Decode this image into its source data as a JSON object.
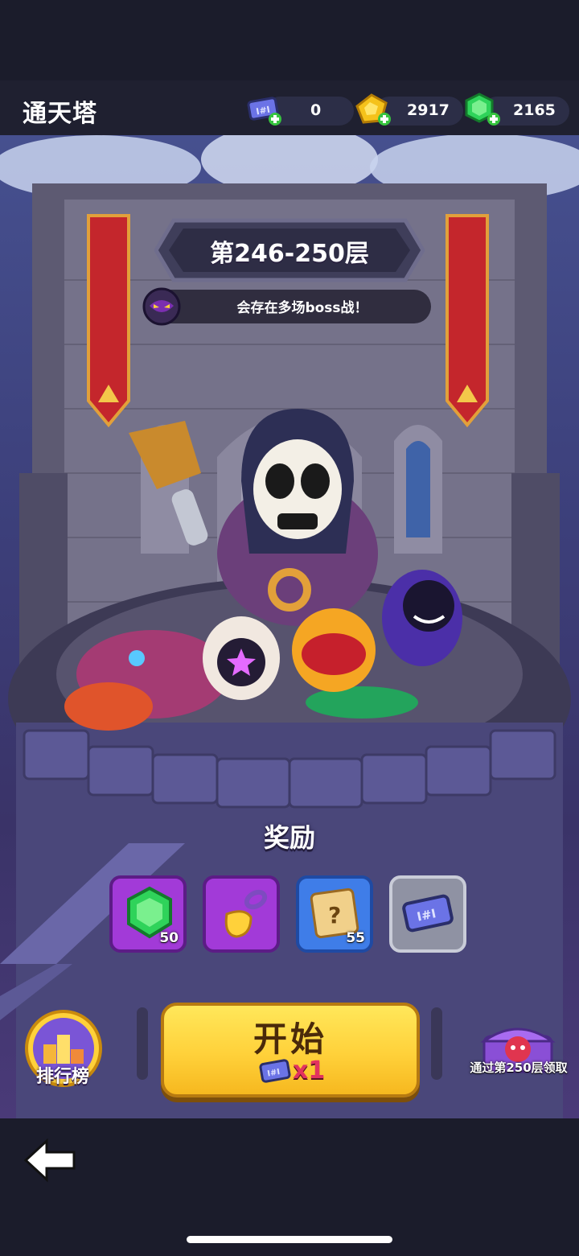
{
  "header": {
    "title": "通天塔",
    "tickets": "0",
    "gold": "2917",
    "gems": "2165"
  },
  "tower": {
    "floor_range": "第246-250层",
    "boss_notice": "会存在多场boss战！"
  },
  "rewards": {
    "label": "奖励",
    "items": [
      {
        "icon": "green-gem-icon",
        "count": "50"
      },
      {
        "icon": "golden-shovel-icon",
        "count": ""
      },
      {
        "icon": "mystery-scroll-icon",
        "count": "55"
      },
      {
        "icon": "ticket-icon",
        "count": ""
      }
    ]
  },
  "actions": {
    "start_label": "开始",
    "start_cost": "x1",
    "leaderboard_label": "排行榜",
    "chest_label": "通过第250层领取"
  },
  "colors": {
    "accent_yellow": "#ffd13a",
    "gem_green": "#2fd35a",
    "banner_red": "#c4262c",
    "slot_purple": "#a23ad8",
    "slot_blue": "#3f7de8",
    "slot_gray": "#b9bcc8"
  }
}
